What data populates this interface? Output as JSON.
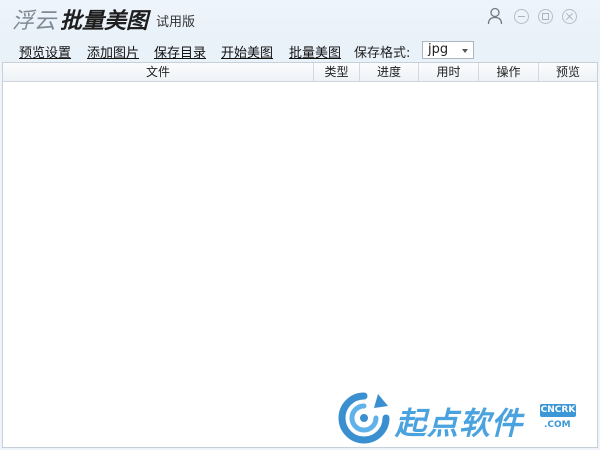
{
  "app": {
    "brand_part1": "浮云",
    "brand_part2": "批量美图",
    "edition": "试用版"
  },
  "toolbar": {
    "links": [
      "预览设置",
      "添加图片",
      "保存目录",
      "开始美图",
      "批量美图"
    ],
    "format_label": "保存格式:",
    "format_value": "jpg"
  },
  "table": {
    "columns": [
      "文件",
      "类型",
      "进度",
      "用时",
      "操作",
      "预览"
    ],
    "rows": []
  },
  "watermark": {
    "text": "起点软件",
    "badge": "CNCRK",
    "domain": ".COM"
  },
  "colors": {
    "accent": "#4aa3df",
    "window_bg": "#e9f1f9"
  },
  "icons": [
    "user-icon",
    "minimize-icon",
    "maximize-icon",
    "close-icon",
    "dropdown-arrow-icon"
  ]
}
